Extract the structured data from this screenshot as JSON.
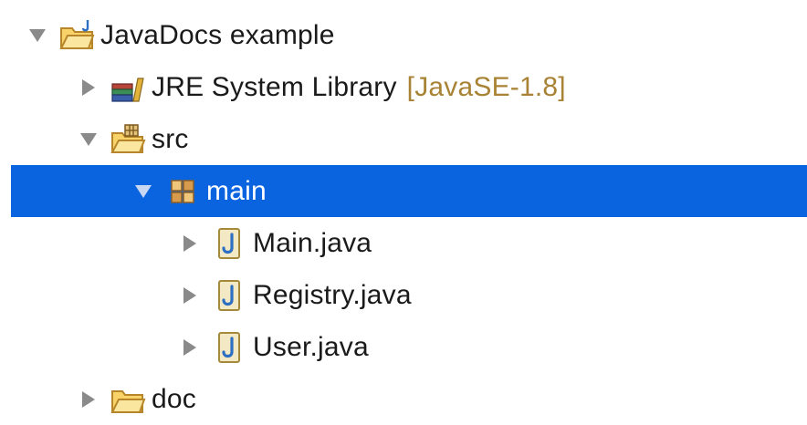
{
  "tree": {
    "project": {
      "label": "JavaDocs example",
      "icon": "java-project-folder-icon",
      "expanded": true
    },
    "jre": {
      "label": "JRE System Library",
      "decoration": "[JavaSE-1.8]",
      "icon": "library-icon",
      "expanded": false
    },
    "src": {
      "label": "src",
      "icon": "source-folder-icon",
      "expanded": true
    },
    "package": {
      "label": "main",
      "icon": "package-icon",
      "expanded": true,
      "selected": true
    },
    "files": [
      {
        "label": "Main.java",
        "icon": "java-file-icon",
        "expanded": false
      },
      {
        "label": "Registry.java",
        "icon": "java-file-icon",
        "expanded": false
      },
      {
        "label": "User.java",
        "icon": "java-file-icon",
        "expanded": false
      }
    ],
    "doc": {
      "label": "doc",
      "icon": "folder-icon",
      "expanded": false
    }
  },
  "colors": {
    "selection": "#0a64e0",
    "decoration": "#a98335",
    "folder": "#f0c24b",
    "java_icon_blue": "#2d6fc3"
  }
}
